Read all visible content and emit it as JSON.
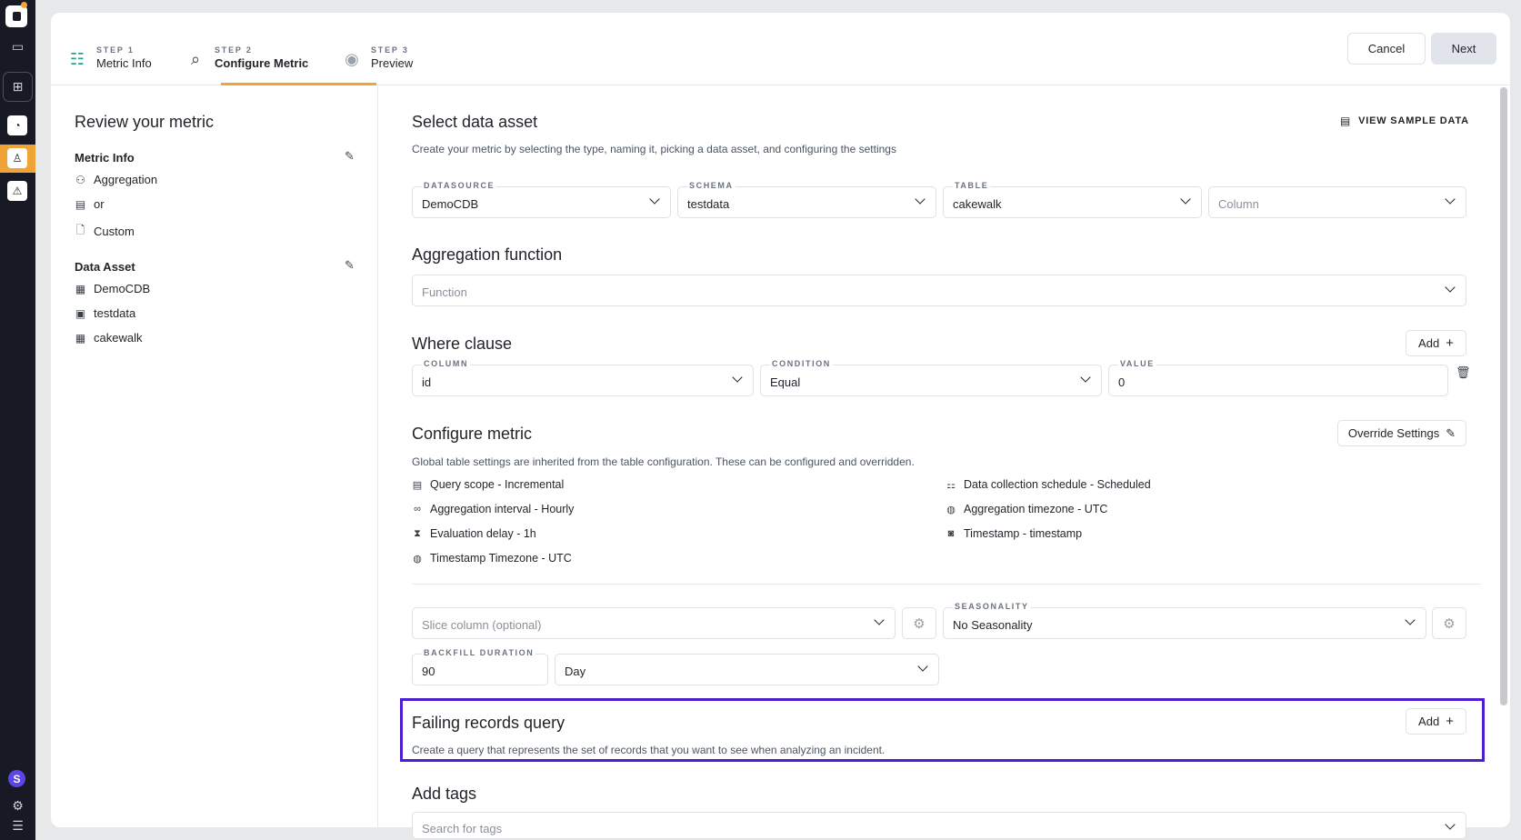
{
  "steps": [
    {
      "num": "STEP 1",
      "label": "Metric Info"
    },
    {
      "num": "STEP 2",
      "label": "Configure Metric"
    },
    {
      "num": "STEP 3",
      "label": "Preview"
    }
  ],
  "actions": {
    "cancel": "Cancel",
    "next": "Next"
  },
  "review": {
    "title": "Review your metric",
    "metric_info": {
      "heading": "Metric Info",
      "items": [
        "Aggregation",
        "or",
        "Custom"
      ]
    },
    "data_asset": {
      "heading": "Data Asset",
      "items": [
        "DemoCDB",
        "testdata",
        "cakewalk"
      ]
    }
  },
  "select_asset": {
    "title": "Select data asset",
    "view_sample": "VIEW SAMPLE DATA",
    "description": "Create your metric by selecting the type, naming it, picking a data asset, and configuring the settings",
    "datasource": {
      "label": "DATASOURCE",
      "value": "DemoCDB"
    },
    "schema": {
      "label": "SCHEMA",
      "value": "testdata"
    },
    "table": {
      "label": "TABLE",
      "value": "cakewalk"
    },
    "column": {
      "placeholder": "Column"
    }
  },
  "aggregation": {
    "title": "Aggregation function",
    "placeholder": "Function"
  },
  "where": {
    "title": "Where clause",
    "add": "Add",
    "column": {
      "label": "COLUMN",
      "value": "id"
    },
    "condition": {
      "label": "CONDITION",
      "value": "Equal"
    },
    "value": {
      "label": "VALUE",
      "value": "0"
    }
  },
  "configure": {
    "title": "Configure metric",
    "override": "Override Settings",
    "description": "Global table settings are inherited from the table configuration. These can be configured and overridden.",
    "left": [
      "Query scope - Incremental",
      "Aggregation interval - Hourly",
      "Evaluation delay - 1h",
      "Timestamp Timezone - UTC"
    ],
    "right": [
      "Data collection schedule - Scheduled",
      "Aggregation timezone - UTC",
      "Timestamp - timestamp"
    ]
  },
  "slice": {
    "placeholder": "Slice column (optional)"
  },
  "seasonality": {
    "label": "SEASONALITY",
    "value": "No Seasonality"
  },
  "backfill": {
    "label": "BACKFILL DURATION",
    "value": "90",
    "unit": "Day"
  },
  "failing": {
    "title": "Failing records query",
    "add": "Add",
    "description": "Create a query that represents the set of records that you want to see when analyzing an incident."
  },
  "tags": {
    "title": "Add tags",
    "placeholder": "Search for tags"
  },
  "colors": {
    "accent": "#f0a436",
    "highlight": "#4b1fcf",
    "rail": "#171a24"
  }
}
